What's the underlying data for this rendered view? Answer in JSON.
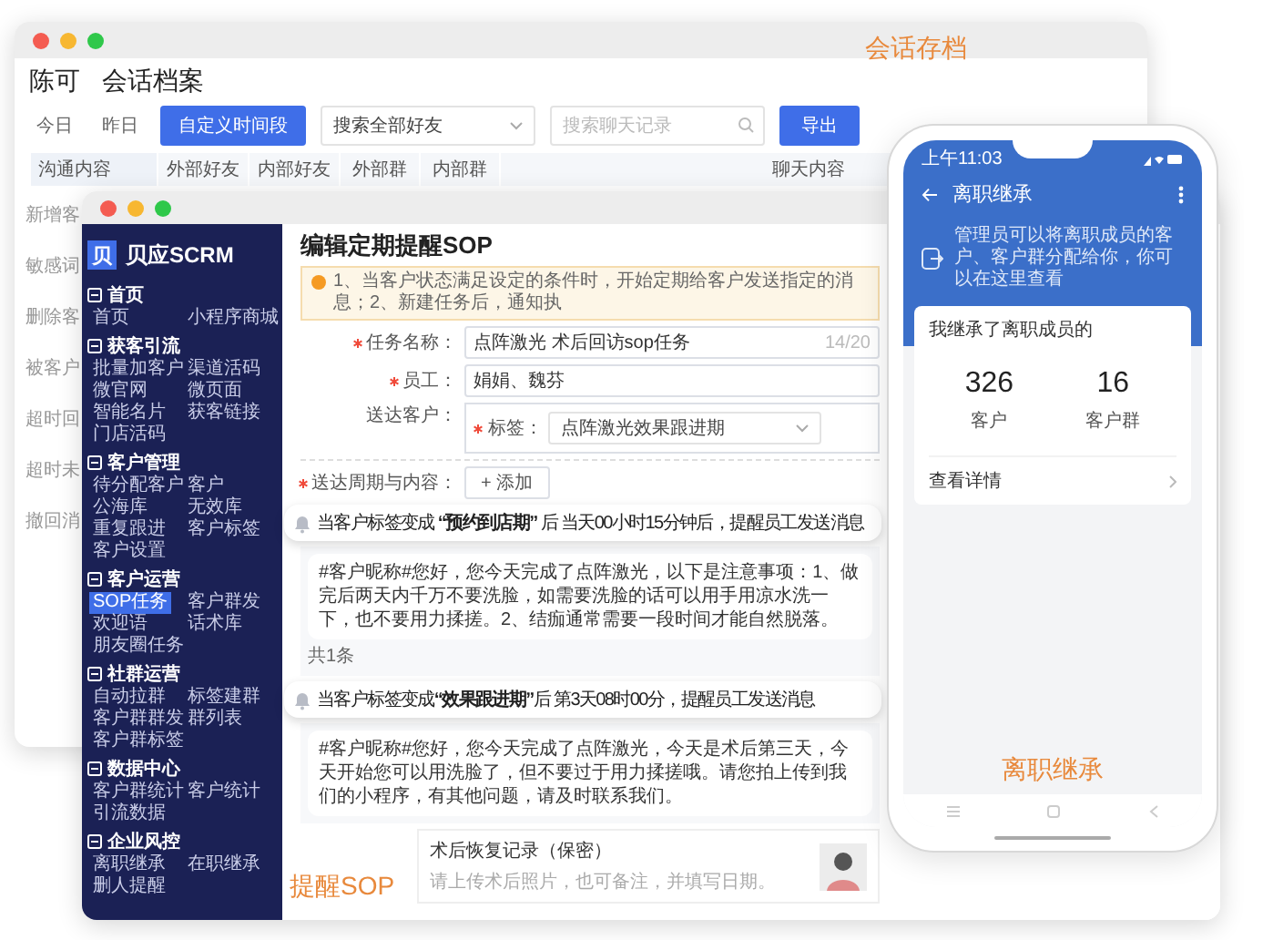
{
  "caption_session": "会话存档",
  "session_window": {
    "owner": "陈可",
    "title": "会话档案",
    "date_filters": [
      {
        "label": "今日",
        "selected": false
      },
      {
        "label": "昨日",
        "selected": false
      },
      {
        "label": "自定义时间段",
        "selected": true
      }
    ],
    "friend_select": {
      "value": "搜索全部好友"
    },
    "search": {
      "placeholder": "搜索聊天记录"
    },
    "export_button": "导出",
    "columns": [
      "沟通内容",
      "外部好友",
      "内部好友",
      "外部群",
      "内部群",
      "聊天内容"
    ],
    "rows": [
      "新增客",
      "敏感词",
      "删除客",
      "被客户",
      "超时回",
      "超时未",
      "撤回消"
    ]
  },
  "sop_window": {
    "logo": "贝",
    "brand": "贝应SCRM",
    "nav": [
      {
        "title": "首页",
        "items": [
          {
            "label": "首页",
            "selected": false
          },
          {
            "label": "小程序商城",
            "selected": false
          }
        ]
      },
      {
        "title": "获客引流",
        "items": [
          {
            "label": "批量加客户",
            "selected": false
          },
          {
            "label": "渠道活码",
            "selected": false
          },
          {
            "label": "微官网",
            "selected": false
          },
          {
            "label": "微页面",
            "selected": false
          },
          {
            "label": "智能名片",
            "selected": false
          },
          {
            "label": "获客链接",
            "selected": false
          },
          {
            "label": "门店活码",
            "selected": false
          }
        ]
      },
      {
        "title": "客户管理",
        "items": [
          {
            "label": "待分配客户",
            "selected": false
          },
          {
            "label": "客户",
            "selected": false
          },
          {
            "label": "公海库",
            "selected": false
          },
          {
            "label": "无效库",
            "selected": false
          },
          {
            "label": "重复跟进",
            "selected": false
          },
          {
            "label": "客户标签",
            "selected": false
          },
          {
            "label": "客户设置",
            "selected": false
          }
        ]
      },
      {
        "title": "客户运营",
        "items": [
          {
            "label": "SOP任务",
            "selected": true
          },
          {
            "label": "客户群发",
            "selected": false
          },
          {
            "label": "欢迎语",
            "selected": false
          },
          {
            "label": "话术库",
            "selected": false
          },
          {
            "label": "朋友圈任务",
            "selected": false
          }
        ]
      },
      {
        "title": "社群运营",
        "items": [
          {
            "label": "自动拉群",
            "selected": false
          },
          {
            "label": "标签建群",
            "selected": false
          },
          {
            "label": "客户群群发",
            "selected": false
          },
          {
            "label": "群列表",
            "selected": false
          },
          {
            "label": "客户群标签",
            "selected": false
          }
        ]
      },
      {
        "title": "数据中心",
        "items": [
          {
            "label": "客户群统计",
            "selected": false
          },
          {
            "label": "客户统计",
            "selected": false
          },
          {
            "label": "引流数据",
            "selected": false
          }
        ]
      },
      {
        "title": "企业风控",
        "items": [
          {
            "label": "离职继承",
            "selected": false
          },
          {
            "label": "在职继承",
            "selected": false
          },
          {
            "label": "删人提醒",
            "selected": false
          }
        ]
      }
    ],
    "page_title": "编辑定期提醒SOP",
    "notice": "1、当客户状态满足设定的条件时，开始定期给客户发送指定的消息；2、新建任务后，通知执",
    "fields": [
      {
        "label": "任务名称：",
        "required": true,
        "value": "点阵激光 术后回访sop任务",
        "counter": "14/20"
      },
      {
        "label": "员工：",
        "required": true,
        "value": "娟娟、魏芬"
      }
    ],
    "recipients": {
      "label": "送达客户：",
      "tag_label": "标签：",
      "tag_required": true,
      "tag_value": "点阵激光效果跟进期"
    },
    "schedule": {
      "label": "送达周期与内容：",
      "required": true,
      "add_button": "+ 添加"
    },
    "messages": [
      {
        "rule": "当客户标签变成 **“预约到店期”** 后 当天00小时15分钟后，提醒员工发送消息",
        "content": "#客户昵称#您好，您今天完成了点阵激光，以下是注意事项：1、做完后两天内千万不要洗脸，如需要洗脸的话可以用手用凉水洗一下，也不要用力揉搓。2、结痂通常需要一段时间才能自然脱落。",
        "footer": "共1条"
      },
      {
        "rule": "当客户标签变成**“效果跟进期”**后 第3天08时00分，提醒员工发送消息",
        "content": "#客户昵称#您好，您今天完成了点阵激光，今天是术后第三天，今天开始您可以用洗脸了，但不要过于用力揉搓哦。请您拍上传到我们的小程序，有其他问题，请及时联系我们。"
      }
    ],
    "form_card": {
      "title": "术后恢复记录（保密）",
      "hint": "请上传术后照片，也可备注，并填写日期。"
    },
    "caption": "提醒SOP"
  },
  "phone": {
    "time": "上午11:03",
    "title": "离职继承",
    "notice": "管理员可以将离职成员的客户、客户群分配给你，你可以在这里查看",
    "card_title": "我继承了离职成员的",
    "stats": [
      {
        "value": "326",
        "label": "客户"
      },
      {
        "value": "16",
        "label": "客户群"
      }
    ],
    "detail_link": "查看详情",
    "caption": "离职继承"
  }
}
